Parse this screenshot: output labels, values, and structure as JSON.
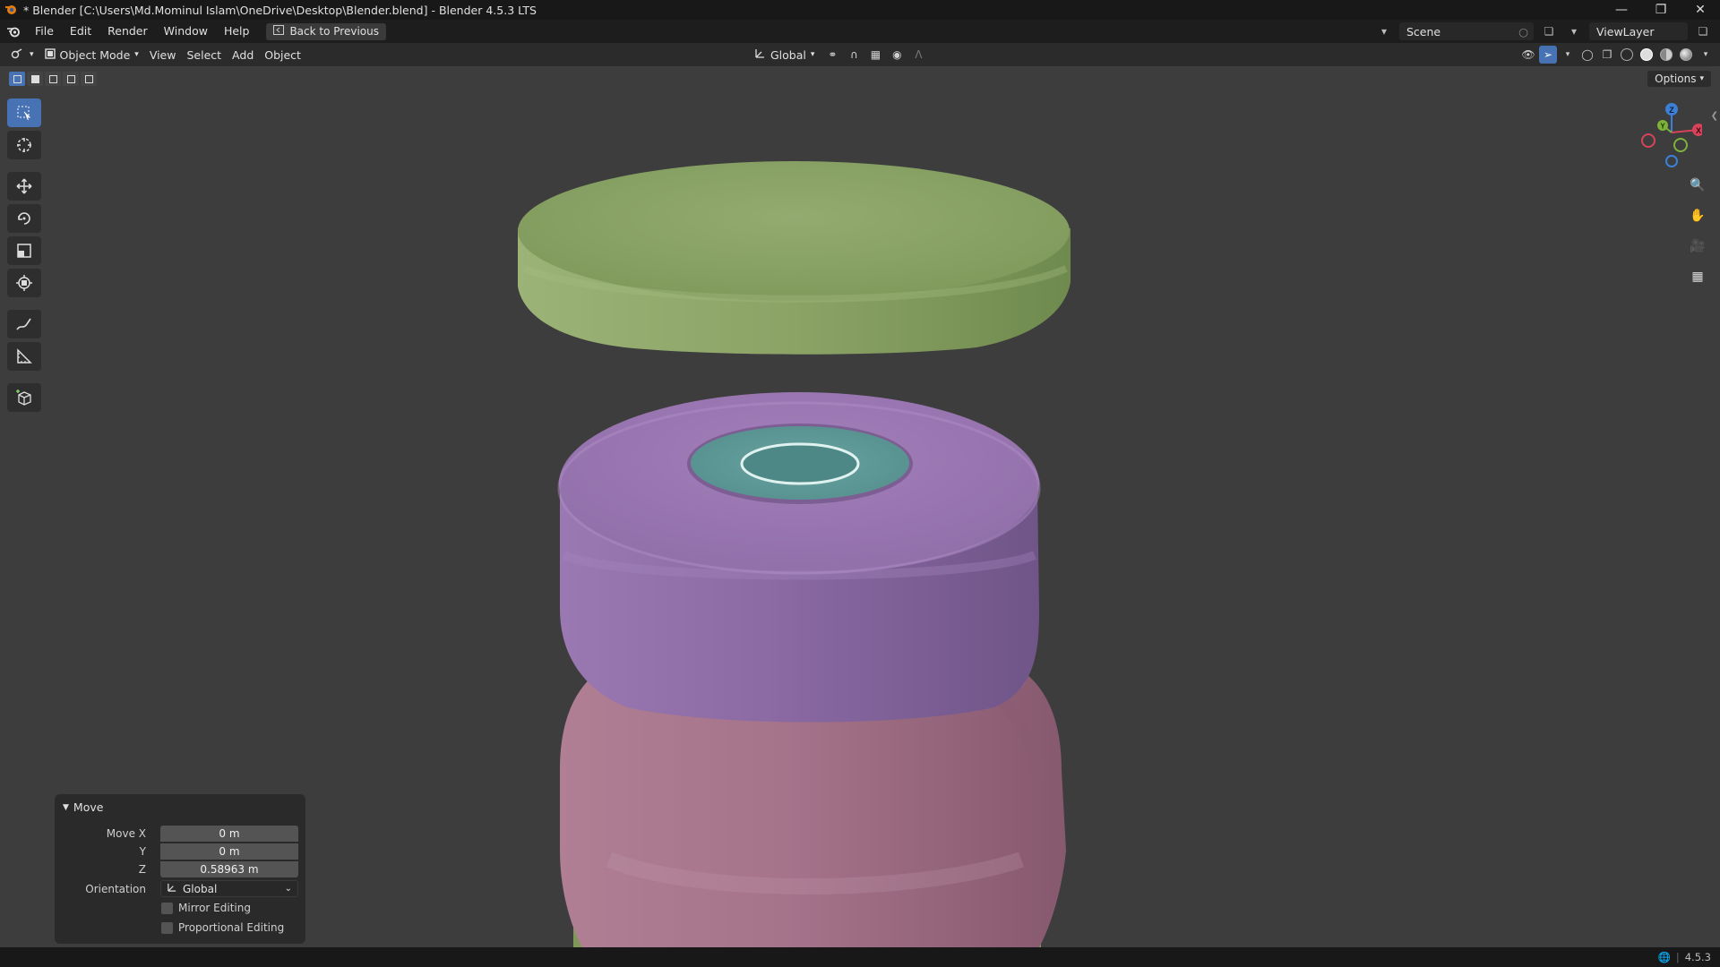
{
  "window": {
    "title": "* Blender [C:\\Users\\Md.Mominul Islam\\OneDrive\\Desktop\\Blender.blend] - Blender 4.5.3 LTS"
  },
  "menu": {
    "items": [
      "File",
      "Edit",
      "Render",
      "Window",
      "Help"
    ],
    "back_button": "Back to Previous",
    "scene_name": "Scene",
    "view_layer": "ViewLayer"
  },
  "header": {
    "mode": "Object Mode",
    "menus": [
      "View",
      "Select",
      "Add",
      "Object"
    ],
    "orientation": "Global",
    "options": "Options"
  },
  "gizmo": {
    "axes": {
      "x": "X",
      "y": "Y",
      "z": "Z"
    }
  },
  "operator_panel": {
    "title": "Move",
    "move_x_label": "Move X",
    "move_x_value": "0 m",
    "y_label": "Y",
    "y_value": "0 m",
    "z_label": "Z",
    "z_value": "0.58963 m",
    "orientation_label": "Orientation",
    "orientation_value": "Global",
    "mirror_editing": "Mirror Editing",
    "proportional_editing": "Proportional Editing"
  },
  "status": {
    "version": "4.5.3"
  },
  "colors": {
    "accent": "#4772b3",
    "green_object": "#8fa66a",
    "purple_object": "#8e6aa0",
    "pink_object": "#a26e82",
    "teal_inset": "#5f9896",
    "axis_x": "#d6435a",
    "axis_y": "#7fb23a",
    "axis_z": "#3c7fd6"
  }
}
